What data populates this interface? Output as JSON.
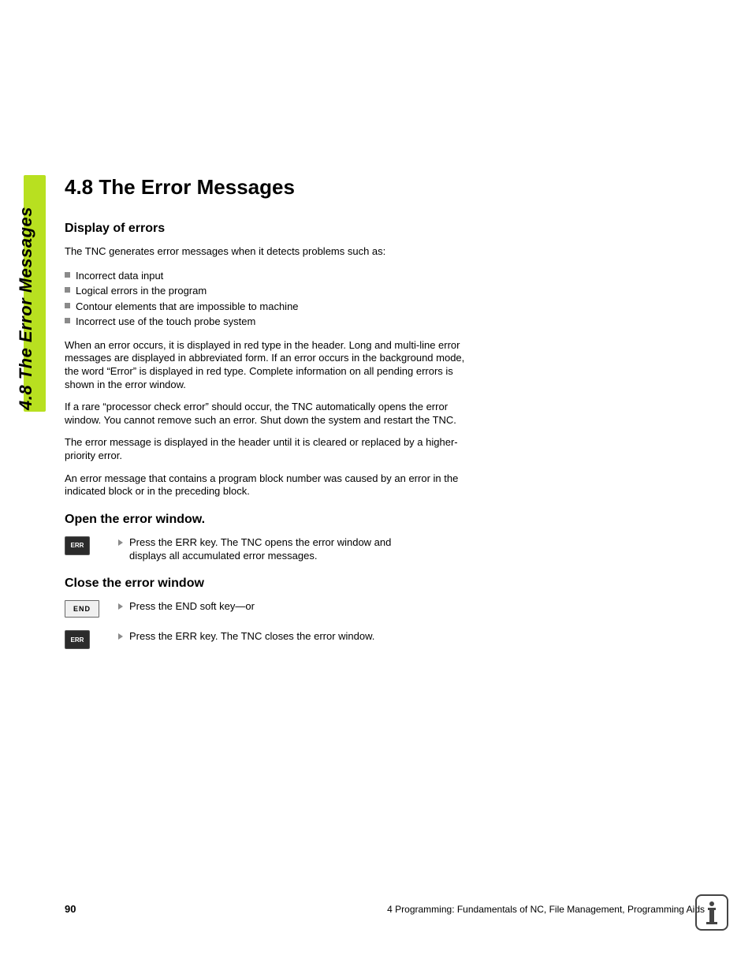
{
  "side_tab_label": "4.8 The Error Messages",
  "heading": "4.8  The Error Messages",
  "sections": {
    "display": {
      "title": "Display of errors",
      "intro": "The TNC generates error messages when it detects problems such as:",
      "bullets": [
        "Incorrect data input",
        "Logical errors in the program",
        "Contour elements that are impossible to machine",
        "Incorrect use of the touch probe system"
      ],
      "para1": "When an error occurs, it is displayed in red type in the header. Long and multi-line error messages are displayed in abbreviated form. If an error occurs in the background mode, the word “Error” is displayed in red type. Complete information on all pending errors is shown in the error window.",
      "para2": "If a rare “processor check error” should occur, the TNC automatically opens the error window. You cannot remove such an error. Shut down the system and restart the TNC.",
      "para3": "The error message is displayed in the header until it is cleared or replaced by a higher-priority error.",
      "para4": "An error message that contains a program block number was caused by an error in the indicated block or in the preceding block."
    },
    "open": {
      "title": "Open the error window.",
      "key_label": "ERR",
      "text": "Press the ERR key. The TNC opens the error window and displays all accumulated error messages."
    },
    "close": {
      "title": "Close the error window",
      "key1_label": "END",
      "text1": "Press the END soft key—or",
      "key2_label": "ERR",
      "text2": "Press the ERR key. The TNC closes the error window."
    }
  },
  "footer": {
    "page_number": "90",
    "chapter": "4 Programming: Fundamentals of NC, File Management, Programming Aids"
  }
}
